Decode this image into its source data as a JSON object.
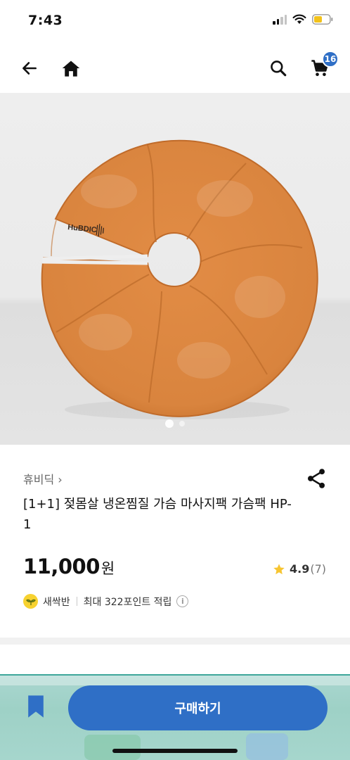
{
  "status": {
    "time": "7:43"
  },
  "nav": {
    "cart_count": "16"
  },
  "product": {
    "image_brand_text": "HuBDIC",
    "brand": "휴비딕 ›",
    "title": "[1+1] 젖몸살 냉온찜질 가슴 마사지팩 가슴팩 HP-1",
    "price": "11,000",
    "price_unit": "원",
    "rating": "4.9",
    "rating_count": "(7)",
    "grade": "새싹반",
    "points": "최대 322포인트 적립"
  },
  "actions": {
    "buy_label": "구매하기"
  },
  "colors": {
    "accent": "#2f6fc6",
    "star": "#f7c531",
    "pad": "#d9843e"
  }
}
